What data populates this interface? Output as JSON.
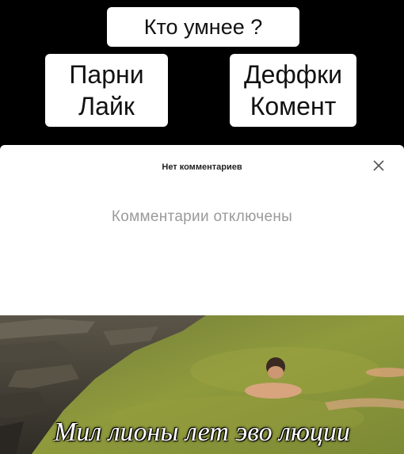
{
  "poll": {
    "question": "Кто умнее ?",
    "left_option": {
      "line1": "Парни",
      "line2": "Лайк"
    },
    "right_option": {
      "line1": "Деффки",
      "line2": "Комент"
    }
  },
  "comments_sheet": {
    "title": "Нет комментариев",
    "close_icon": "close-icon",
    "message": "Комментарии отключены"
  },
  "video": {
    "caption": "Мил лионы лет эво люции"
  }
}
